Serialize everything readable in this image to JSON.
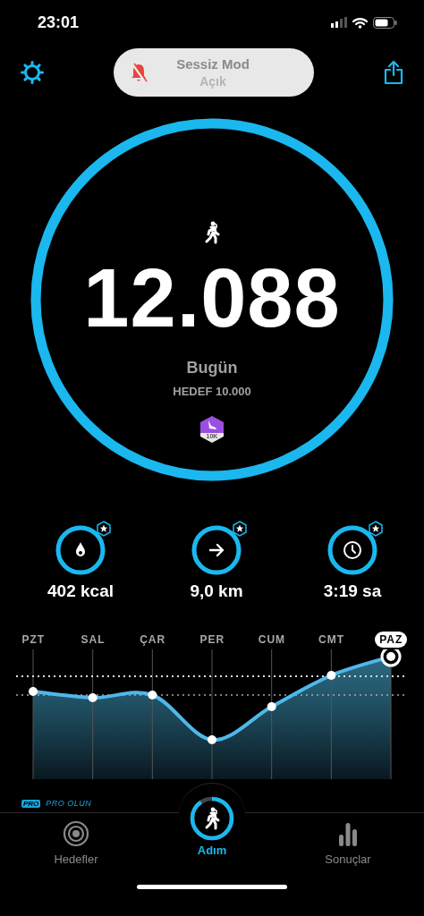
{
  "status_bar": {
    "time": "23:01"
  },
  "header": {
    "silent_mode": {
      "title": "Sessiz Mod",
      "state": "Açık"
    }
  },
  "ring": {
    "level": 1,
    "count": "12.088",
    "label": "Bugün",
    "goal": "HEDEF 10.000",
    "badge": "10K"
  },
  "stats": [
    {
      "kind": "calories",
      "value": "402 kcal",
      "level": 1,
      "starred": true
    },
    {
      "kind": "distance",
      "value": "9,0 km",
      "level": 1,
      "starred": true
    },
    {
      "kind": "time",
      "value": "3:19 sa",
      "level": 1,
      "starred": true
    }
  ],
  "week_chart": {
    "days": [
      {
        "label": "PZT",
        "selected": false
      },
      {
        "label": "SAL",
        "selected": false
      },
      {
        "label": "ÇAR",
        "selected": false
      },
      {
        "label": "PER",
        "selected": false
      },
      {
        "label": "CUM",
        "selected": false
      },
      {
        "label": "CMT",
        "selected": false
      },
      {
        "label": "PAZ",
        "selected": true
      }
    ]
  },
  "pro": {
    "badge": "PRO",
    "label": "PRO OLUN"
  },
  "tab_bar": [
    {
      "kind": "goals",
      "label": "Hedefler",
      "selected": false
    },
    {
      "kind": "steps",
      "label": "Adım",
      "selected": true
    },
    {
      "kind": "results",
      "label": "Sonuçlar",
      "selected": false
    }
  ]
}
